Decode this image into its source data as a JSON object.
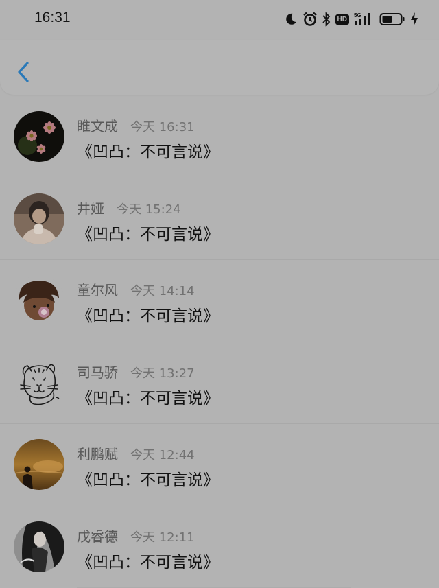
{
  "status_bar": {
    "time": "16:31",
    "network_label": "5G",
    "hd_label": "HD",
    "icons": [
      "moon-icon",
      "alarm-icon",
      "bluetooth-icon",
      "hd-icon",
      "signal-icon",
      "battery-icon",
      "charging-icon"
    ]
  },
  "nav": {
    "back_icon": "chevron-left-icon",
    "accent": "#2a79b8"
  },
  "comments": [
    {
      "name": "睢文成",
      "day": "今天",
      "time": "16:31",
      "message": "《凹凸：不可言说》",
      "avatar": "pink-daisies"
    },
    {
      "name": "井娅",
      "day": "今天",
      "time": "15:24",
      "message": "《凹凸：不可言说》",
      "avatar": "girl-photo"
    },
    {
      "name": "童尔风",
      "day": "今天",
      "time": "14:14",
      "message": "《凹凸：不可言说》",
      "avatar": "anime-character"
    },
    {
      "name": "司马骄",
      "day": "今天",
      "time": "13:27",
      "message": "《凹凸：不可言说》",
      "avatar": "cartoon-tiger-sketch"
    },
    {
      "name": "利鹏赋",
      "day": "今天",
      "time": "12:44",
      "message": "《凹凸：不可言说》",
      "avatar": "sunset-silhouette"
    },
    {
      "name": "戊睿德",
      "day": "今天",
      "time": "12:11",
      "message": "《凹凸：不可言说》",
      "avatar": "dark-anime-art"
    }
  ]
}
